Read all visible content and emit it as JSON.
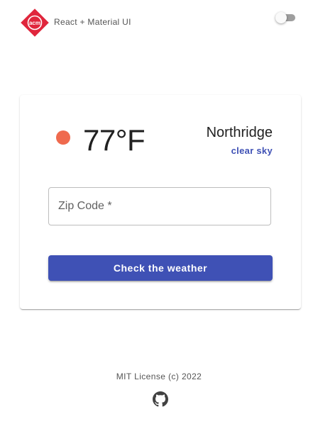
{
  "header": {
    "logo_text": "acm",
    "brand": "React + Material UI"
  },
  "weather": {
    "temperature": "77°F",
    "city": "Northridge",
    "description": "clear sky",
    "status_color": "#ef6a4e"
  },
  "form": {
    "zip_placeholder": "Zip Code *",
    "submit_label": "Check the weather"
  },
  "footer": {
    "license": "MIT License (c) 2022"
  },
  "colors": {
    "primary": "#3f51b5",
    "logo_red": "#e0263c"
  },
  "icons": {
    "logo": "acm-logo",
    "theme": "theme-toggle-switch",
    "github": "github-icon"
  }
}
